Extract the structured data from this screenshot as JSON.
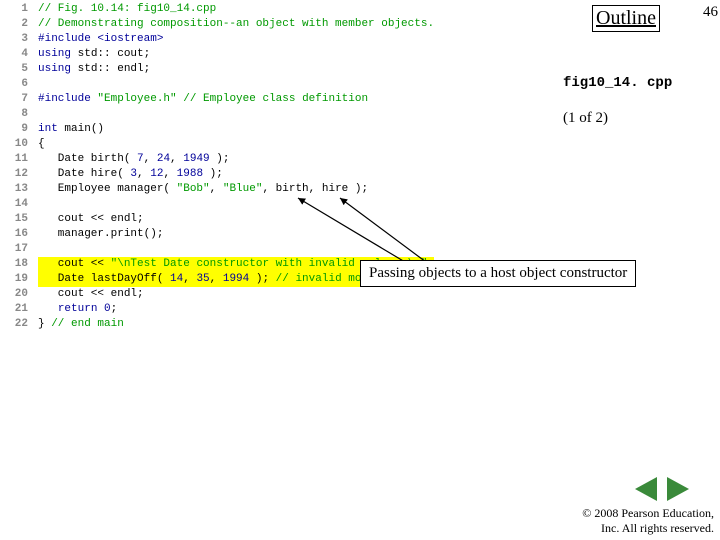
{
  "page": {
    "outline": "Outline",
    "number": "46",
    "filename": "fig10_14. cpp",
    "pageof": "(1 of 2)",
    "copyright": "© 2008 Pearson Education,\nInc. All rights reserved."
  },
  "callout": {
    "text": "Passing objects to a host object constructor"
  },
  "code": [
    {
      "n": "1",
      "seg": [
        {
          "c": "comment",
          "t": "// Fig. 10.14: fig10_14.cpp"
        }
      ]
    },
    {
      "n": "2",
      "seg": [
        {
          "c": "comment",
          "t": "// Demonstrating composition--an object with member objects."
        }
      ]
    },
    {
      "n": "3",
      "seg": [
        {
          "c": "preproc",
          "t": "#include "
        },
        {
          "c": "preproc",
          "t": "<iostream>"
        }
      ]
    },
    {
      "n": "4",
      "seg": [
        {
          "c": "keyword",
          "t": "using"
        },
        {
          "t": " std::"
        },
        {
          "t": " cout;"
        }
      ]
    },
    {
      "n": "5",
      "seg": [
        {
          "c": "keyword",
          "t": "using"
        },
        {
          "t": " std::"
        },
        {
          "t": " endl;"
        }
      ]
    },
    {
      "n": "6",
      "seg": []
    },
    {
      "n": "7",
      "seg": [
        {
          "c": "preproc",
          "t": "#include "
        },
        {
          "c": "string",
          "t": "\"Employee.h\""
        },
        {
          "t": " "
        },
        {
          "c": "comment",
          "t": "// Employee class definition"
        }
      ]
    },
    {
      "n": "8",
      "seg": []
    },
    {
      "n": "9",
      "seg": [
        {
          "c": "keyword",
          "t": "int"
        },
        {
          "t": " main()"
        }
      ]
    },
    {
      "n": "10",
      "seg": [
        {
          "t": "{"
        }
      ]
    },
    {
      "n": "11",
      "seg": [
        {
          "t": "   Date birth( "
        },
        {
          "c": "num",
          "t": "7"
        },
        {
          "t": ", "
        },
        {
          "c": "num",
          "t": "24"
        },
        {
          "t": ", "
        },
        {
          "c": "num",
          "t": "1949"
        },
        {
          "t": " );"
        }
      ]
    },
    {
      "n": "12",
      "seg": [
        {
          "t": "   Date hire( "
        },
        {
          "c": "num",
          "t": "3"
        },
        {
          "t": ", "
        },
        {
          "c": "num",
          "t": "12"
        },
        {
          "t": ", "
        },
        {
          "c": "num",
          "t": "1988"
        },
        {
          "t": " );"
        }
      ]
    },
    {
      "n": "13",
      "seg": [
        {
          "t": "   Employee manager( "
        },
        {
          "c": "string",
          "t": "\"Bob\""
        },
        {
          "t": ", "
        },
        {
          "c": "string",
          "t": "\"Blue\""
        },
        {
          "t": ", birth, hire );"
        }
      ]
    },
    {
      "n": "14",
      "seg": []
    },
    {
      "n": "15",
      "seg": [
        {
          "t": "   cout << endl;"
        }
      ]
    },
    {
      "n": "16",
      "seg": [
        {
          "t": "   manager.print();"
        }
      ]
    },
    {
      "n": "17",
      "seg": []
    },
    {
      "n": "18",
      "hl": true,
      "seg": [
        {
          "t": "   cout << "
        },
        {
          "c": "string",
          "t": "\"\\nTest Date constructor with invalid values:\\n\""
        },
        {
          "t": ";"
        }
      ]
    },
    {
      "n": "19",
      "hl": true,
      "seg": [
        {
          "t": "   Date lastDayOff( "
        },
        {
          "c": "num",
          "t": "14"
        },
        {
          "t": ", "
        },
        {
          "c": "num",
          "t": "35"
        },
        {
          "t": ", "
        },
        {
          "c": "num",
          "t": "1994"
        },
        {
          "t": " ); "
        },
        {
          "c": "comment",
          "t": "// invalid month and day"
        }
      ]
    },
    {
      "n": "20",
      "seg": [
        {
          "t": "   cout << endl;"
        }
      ]
    },
    {
      "n": "21",
      "seg": [
        {
          "t": "   "
        },
        {
          "c": "keyword",
          "t": "return"
        },
        {
          "t": " "
        },
        {
          "c": "num",
          "t": "0"
        },
        {
          "t": ";"
        }
      ]
    },
    {
      "n": "22",
      "seg": [
        {
          "t": "} "
        },
        {
          "c": "comment",
          "t": "// end main"
        }
      ]
    }
  ]
}
